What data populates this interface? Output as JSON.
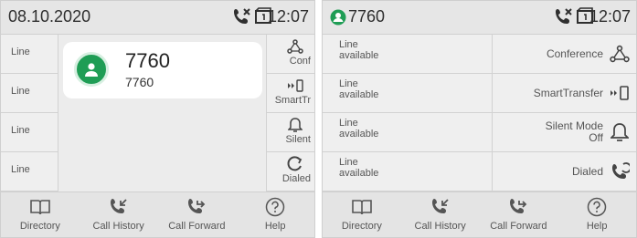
{
  "left": {
    "status": {
      "date": "08.10.2020",
      "time": "12:07",
      "icons": [
        "missed-call-icon",
        "voicemail-icon"
      ]
    },
    "line_keys": [
      "Line",
      "Line",
      "Line",
      "Line"
    ],
    "soft_keys": [
      {
        "label": "Conf",
        "icon": "conference-icon"
      },
      {
        "label": "SmartTr",
        "icon": "smart-transfer-icon"
      },
      {
        "label": "Silent",
        "icon": "bell-icon"
      },
      {
        "label": "Dialed",
        "icon": "redial-icon"
      }
    ],
    "call": {
      "name": "7760",
      "number": "7760",
      "avatar_color": "#1f9d55"
    },
    "bottom": [
      {
        "label": "Directory",
        "icon": "book-icon"
      },
      {
        "label": "Call History",
        "icon": "call-history-icon"
      },
      {
        "label": "Call Forward",
        "icon": "call-forward-icon"
      },
      {
        "label": "Help",
        "icon": "help-icon"
      }
    ]
  },
  "right": {
    "status": {
      "account": "7760",
      "time": "12:07",
      "icons": [
        "account-icon",
        "missed-call-icon",
        "voicemail-icon"
      ]
    },
    "lines": [
      {
        "line1": "Line",
        "line2": "available"
      },
      {
        "line1": "Line",
        "line2": "available"
      },
      {
        "line1": "Line",
        "line2": "available"
      },
      {
        "line1": "Line",
        "line2": "available"
      }
    ],
    "soft_keys": [
      {
        "line1": "Conference",
        "line2": "",
        "icon": "conference-icon"
      },
      {
        "line1": "SmartTransfer",
        "line2": "",
        "icon": "smart-transfer-icon"
      },
      {
        "line1": "Silent Mode",
        "line2": "Off",
        "icon": "bell-icon"
      },
      {
        "line1": "Dialed",
        "line2": "",
        "icon": "redial-icon"
      }
    ],
    "bottom": [
      {
        "label": "Directory",
        "icon": "book-icon"
      },
      {
        "label": "Call History",
        "icon": "call-history-icon"
      },
      {
        "label": "Call Forward",
        "icon": "call-forward-icon"
      },
      {
        "label": "Help",
        "icon": "help-icon"
      }
    ]
  },
  "colors": {
    "accent_green": "#1f9d55",
    "icon_gray": "#555555",
    "panel_bg": "#ececec"
  }
}
